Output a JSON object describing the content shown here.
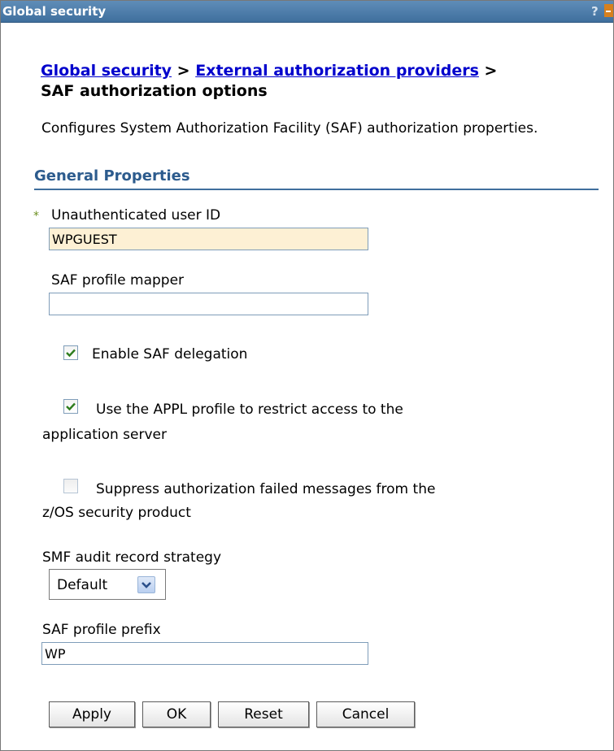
{
  "window": {
    "title": "Global security",
    "help_label": "?"
  },
  "breadcrumb": {
    "link1": "Global security",
    "sep1": " > ",
    "link2": "External authorization providers",
    "sep2": " >",
    "current": "SAF authorization options"
  },
  "description": "Configures System Authorization Facility (SAF) authorization properties.",
  "section_title": "General Properties",
  "fields": {
    "unauthenticated_user_id": {
      "required_marker": "*",
      "label": "Unauthenticated user ID",
      "value": "WPGUEST"
    },
    "saf_profile_mapper": {
      "label": "SAF profile mapper",
      "value": ""
    },
    "enable_saf_delegation": {
      "label": "Enable SAF delegation",
      "checked": true
    },
    "use_appl_profile": {
      "label_line1": "Use the APPL profile to restrict access to the",
      "label_line2": "application server",
      "checked": true
    },
    "suppress_auth_failed": {
      "label_line1": "Suppress authorization failed messages from the",
      "label_line2": "z/OS security product",
      "checked": false
    },
    "smf_audit_record_strategy": {
      "label": "SMF audit record strategy",
      "selected": "Default"
    },
    "saf_profile_prefix": {
      "label": "SAF profile prefix",
      "value": "WP"
    }
  },
  "buttons": {
    "apply": "Apply",
    "ok": "OK",
    "reset": "Reset",
    "cancel": "Cancel"
  },
  "colors": {
    "titlebar": "#3f6f9d",
    "link": "#0000cc",
    "section_title": "#2c5b8d",
    "required_field_bg": "#fdf0d4",
    "checkmark": "#2e7d1e"
  },
  "icons": {
    "checked": "checkmark-icon",
    "dropdown": "chevron-down-icon",
    "minimize": "minimize-icon"
  }
}
